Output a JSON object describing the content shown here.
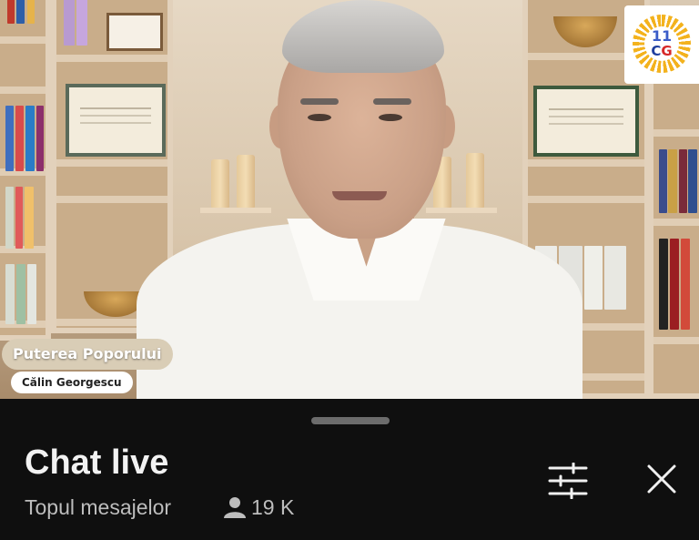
{
  "video": {
    "channel_tag": "Puterea Poporului",
    "speaker_name": "Călin Georgescu",
    "logo": {
      "number": "11",
      "letters_left": "C",
      "letters_right": "G",
      "icon": "sun-emblem-icon"
    }
  },
  "chat": {
    "title": "Chat live",
    "mode_label": "Topul mesajelor",
    "viewer_count": "19 K",
    "icons": {
      "viewers": "person-icon",
      "filter": "sliders-icon",
      "close": "close-icon"
    }
  },
  "colors": {
    "panel_bg": "#0f0f0f",
    "title": "#f2f2f2",
    "subtitle": "#bdbdbd",
    "handle": "#6c6c6c",
    "channel_tag_bg": "#d9cdb6"
  }
}
